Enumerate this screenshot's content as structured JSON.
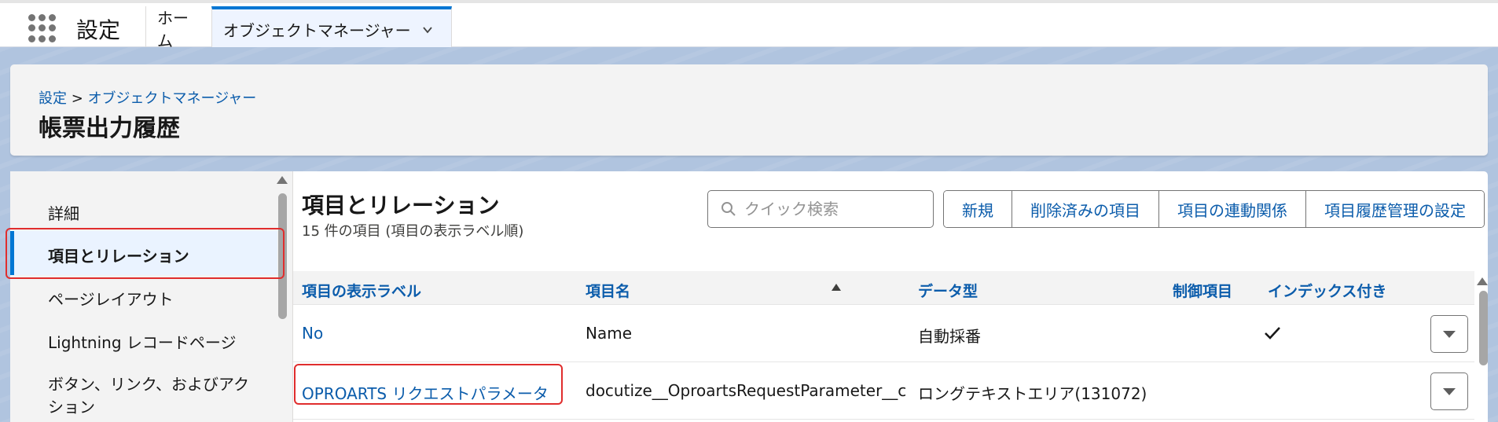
{
  "app": {
    "title": "設定"
  },
  "nav": {
    "home_tab": "ホーム",
    "active_tab": "オブジェクトマネージャー"
  },
  "header": {
    "breadcrumb": {
      "root": "設定",
      "separator": ">",
      "current": "オブジェクトマネージャー"
    },
    "title": "帳票出力履歴"
  },
  "sidebar": {
    "items": [
      {
        "label": "詳細"
      },
      {
        "label": "項目とリレーション"
      },
      {
        "label": "ページレイアウト"
      },
      {
        "label": "Lightning レコードページ"
      },
      {
        "label": "ボタン、リンク、およびアク"
      },
      {
        "label": "ション"
      }
    ]
  },
  "main": {
    "title": "項目とリレーション",
    "subtitle": "15 件の項目 (項目の表示ラベル順)",
    "search": {
      "placeholder": "クイック検索",
      "value": ""
    },
    "buttons": [
      "新規",
      "削除済みの項目",
      "項目の連動関係",
      "項目履歴管理の設定"
    ],
    "table": {
      "columns": [
        "項目の表示ラベル",
        "項目名",
        "データ型",
        "制御項目",
        "インデックス付き"
      ],
      "rows": [
        {
          "label": "No",
          "api_name": "Name",
          "type": "自動採番",
          "controlling": "",
          "indexed": true
        },
        {
          "label": "OPROARTS リクエストパラメータ",
          "api_name": "docutize__OproartsRequestParameter__c",
          "type": "ロングテキストエリア(131072)",
          "controlling": "",
          "indexed": false
        }
      ]
    }
  },
  "colors": {
    "brand_blue": "#0176d3",
    "link_blue": "#0b5cab",
    "highlight_red": "#e02d2d",
    "background_band": "#b0c4df"
  }
}
